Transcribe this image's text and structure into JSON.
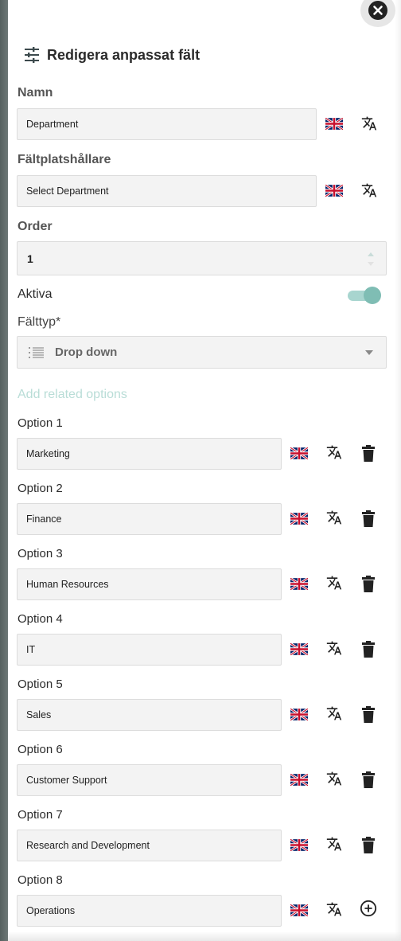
{
  "header": {
    "title": "Redigera anpassat fält",
    "icon": "tune-sliders-icon"
  },
  "fields": {
    "name": {
      "label": "Namn",
      "value": "Department"
    },
    "placeholder": {
      "label": "Fältplatshållare",
      "value": "Select Department"
    },
    "order": {
      "label": "Order",
      "value": "1"
    },
    "active": {
      "label": "Aktiva",
      "enabled": true
    },
    "field_type": {
      "label": "Fälttyp*",
      "value": "Drop down",
      "icon": "list-icon"
    }
  },
  "options_section": {
    "add_label": "Add related options"
  },
  "options": [
    {
      "label": "Option 1",
      "value": "Marketing"
    },
    {
      "label": "Option 2",
      "value": "Finance"
    },
    {
      "label": "Option 3",
      "value": "Human Resources"
    },
    {
      "label": "Option 4",
      "value": "IT"
    },
    {
      "label": "Option 5",
      "value": "Sales"
    },
    {
      "label": "Option 6",
      "value": "Customer Support"
    },
    {
      "label": "Option 7",
      "value": "Research and Development"
    },
    {
      "label": "Option 8",
      "value": "Operations"
    }
  ],
  "colors": {
    "accent": "#7fbdb4",
    "accent_light": "#a8d5cf",
    "muted_link": "#b9ddd7"
  }
}
